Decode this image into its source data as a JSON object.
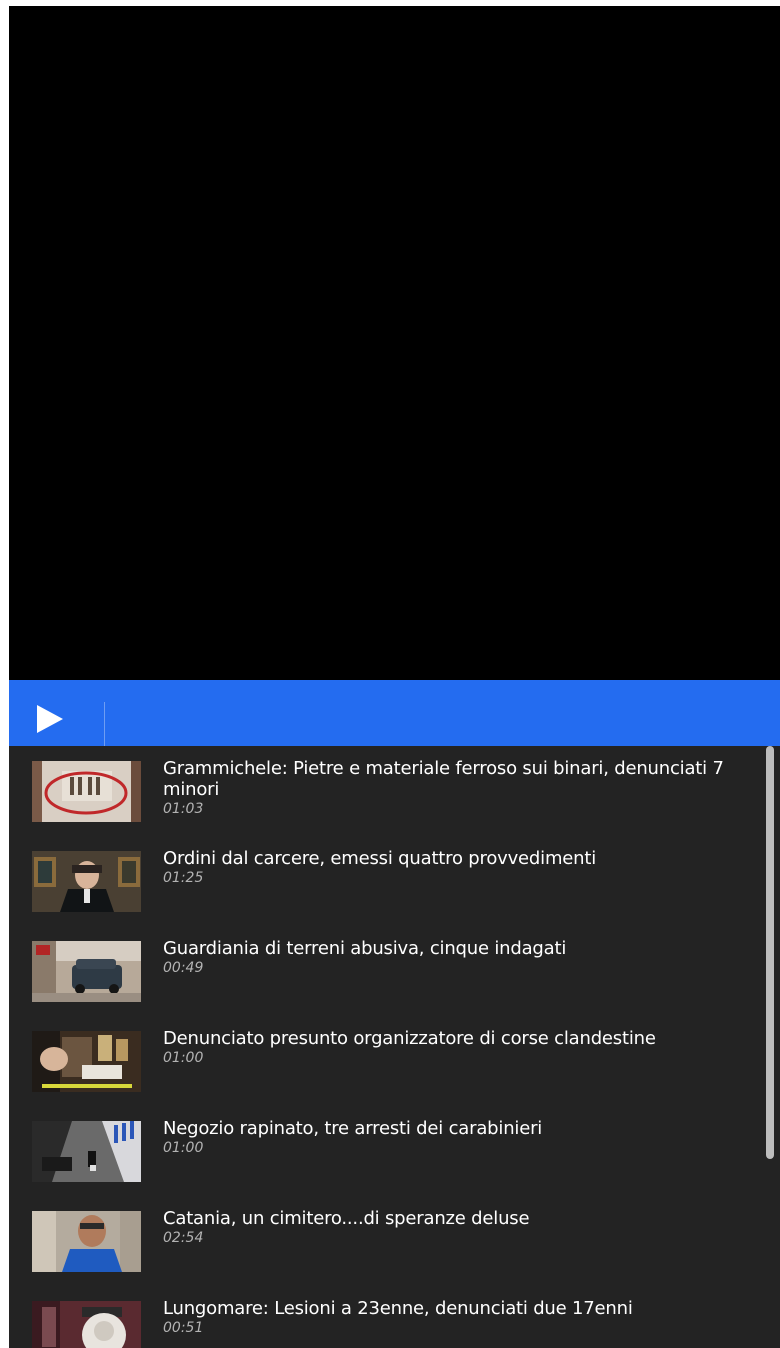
{
  "player": {
    "play_icon": "play-icon"
  },
  "playlist": {
    "items": [
      {
        "title": "Grammichele: Pietre e materiale ferroso sui binari, denunciati 7 minori",
        "duration": "01:03"
      },
      {
        "title": "Ordini dal carcere, emessi quattro provvedimenti",
        "duration": "01:25"
      },
      {
        "title": "Guardiania di terreni abusiva, cinque indagati",
        "duration": "00:49"
      },
      {
        "title": "Denunciato presunto organizzatore di corse clandestine",
        "duration": "01:00"
      },
      {
        "title": "Negozio rapinato, tre arresti dei carabinieri",
        "duration": "01:00"
      },
      {
        "title": "Catania, un cimitero....di speranze deluse",
        "duration": "02:54"
      },
      {
        "title": "Lungomare: Lesioni a 23enne, denunciati due 17enni",
        "duration": "00:51"
      }
    ]
  },
  "colors": {
    "control_bar": "#246cf0",
    "playlist_bg": "#232323",
    "video_bg": "#000000"
  }
}
